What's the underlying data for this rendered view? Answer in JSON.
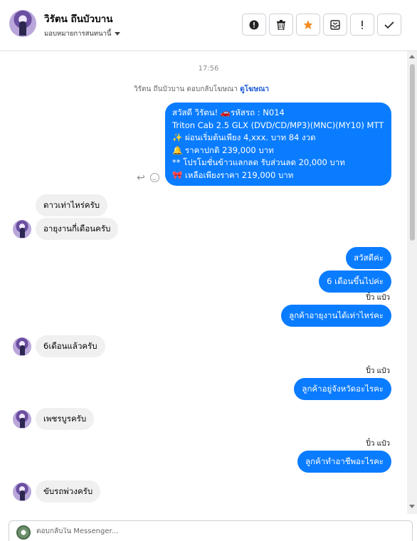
{
  "header": {
    "name": "วิรัตน ถึนบัวบาน",
    "assign_label": "มอบหมายการสนทนานี้",
    "actions": [
      {
        "name": "mark-important-icon",
        "glyph": "!"
      },
      {
        "name": "trash-icon",
        "glyph": "🗑"
      },
      {
        "name": "star-icon",
        "glyph": "★"
      },
      {
        "name": "inbox-icon",
        "glyph": "✉"
      },
      {
        "name": "exclaim-icon",
        "glyph": "!"
      },
      {
        "name": "check-icon",
        "glyph": "✓"
      }
    ],
    "star_color": "#f28b23"
  },
  "conversation": {
    "timestamp": "17:56",
    "reply_note": "วิรัตน ถึนบัวบาน ตอบกลับโฆษณา",
    "reply_link": "ดูโฆษณา",
    "ad_message": [
      "สวัสดี วิรัตน! 🚗รหัสรถ : N014",
      "Triton Cab 2.5 GLX (DVD/CD/MP3)(MNC)(MY10) MTT",
      "✨ ผ่อนเริ่มต้นเพียง 4,xxx. บาท 84 งวด",
      "🔔 ราคาปกติ 239,000 บาท",
      "** โปรโมชั่นข้าวแลกลด รับส่วนลด 20,000 บาท",
      "🎀  เหลือเพียงราคา 219,000 บาท"
    ],
    "messages": [
      {
        "side": "in",
        "text": "ดาวเท่าไหร่ครับ",
        "avatar": false
      },
      {
        "side": "in",
        "text": "อายุงานกี่เดือนครับ",
        "avatar": true
      },
      {
        "side": "out",
        "text": "สวัสดีค่ะ"
      },
      {
        "side": "out",
        "text": "6  เดือนขึ้นไปค่ะ"
      },
      {
        "side": "seen",
        "text": "ปิ๋ว แป๋ว"
      },
      {
        "side": "out",
        "text": "ลูกค้าอายุงานได้เท่าไหร่คะ"
      },
      {
        "side": "in",
        "text": "6เดือนแล้วครับ",
        "avatar": true
      },
      {
        "side": "seen",
        "text": "ปิ๋ว แป๋ว"
      },
      {
        "side": "out",
        "text": "ลูกค้าอยู่จังหวัดอะไรคะ"
      },
      {
        "side": "in",
        "text": "เพชรบูรครับ",
        "avatar": true
      },
      {
        "side": "seen",
        "text": "ปิ๋ว แป๋ว"
      },
      {
        "side": "out",
        "text": "ลูกค้าทำอาชีพอะไรคะ"
      },
      {
        "side": "in",
        "text": "ขับรถพ่วงครับ",
        "avatar": true
      }
    ]
  },
  "composer": {
    "placeholder": "ตอบกลับใน Messenger..."
  },
  "colors": {
    "outgoing_bubble": "#0a7cff",
    "incoming_bubble": "#f0f0f0",
    "link": "#1c5bd6"
  }
}
